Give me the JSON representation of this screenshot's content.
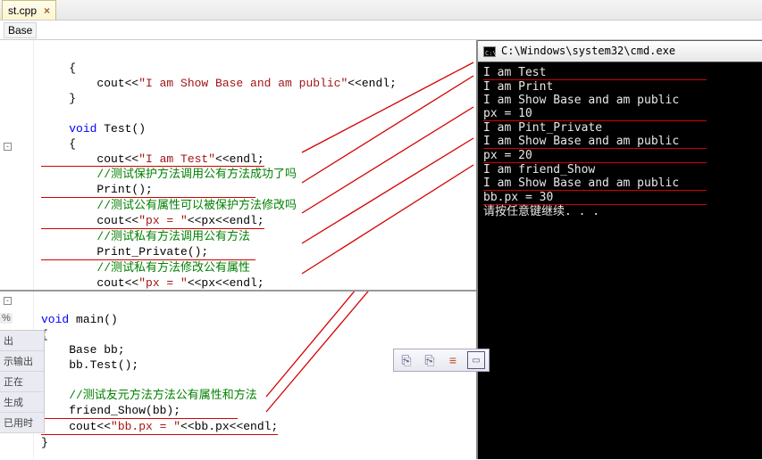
{
  "tab": {
    "name": "st.cpp",
    "close": "×"
  },
  "breadcrumb": {
    "item": "Base"
  },
  "code_top": {
    "l1": "    {",
    "l2a": "        cout<<",
    "l2b": "\"I am Show Base and am public\"",
    "l2c": "<<endl;",
    "l3": "    }",
    "l4": "",
    "l5a": "    ",
    "l5b": "void",
    "l5c": " Test()",
    "l6": "    {",
    "l7a": "        cout<<",
    "l7b": "\"I am Test\"",
    "l7c": "<<endl;",
    "l8": "        //测试保护方法调用公有方法成功了吗",
    "l9": "        Print();",
    "l10": "        //测试公有属性可以被保护方法修改吗",
    "l11a": "        cout<<",
    "l11b": "\"px = \"",
    "l11c": "<<px<<endl;",
    "l12": "        //测试私有方法调用公有方法",
    "l13": "        Print_Private();",
    "l14": "        //测试私有方法修改公有属性",
    "l15a": "        cout<<",
    "l15b": "\"px = \"",
    "l15c": "<<px<<endl;"
  },
  "code_bottom": {
    "l1a": "",
    "l1b": "void",
    "l1c": " main()",
    "l2": "{",
    "l3": "    Base bb;",
    "l4": "    bb.Test();",
    "l5": "",
    "l6": "    //测试友元方法方法公有属性和方法",
    "l7": "    friend_Show(bb);",
    "l8a": "    cout<<",
    "l8b": "\"bb.px = \"",
    "l8c": "<<bb.px<<endl;",
    "l9": "}"
  },
  "side": {
    "pct": "%",
    "s1": "出",
    "s2": "示输出",
    "s3": "  正在",
    "s4": "生成",
    "s5": "已用时"
  },
  "cmd": {
    "title": "C:\\Windows\\system32\\cmd.exe",
    "l1": "I am Test",
    "l2": "I am Print",
    "l3": "I am Show Base and am public",
    "l4": "px = 10",
    "l5": "I am Pint_Private",
    "l6": "I am Show Base and am public",
    "l7": "px = 20",
    "l8": "I am friend_Show",
    "l9": "I am Show Base and am public",
    "l10": "bb.px = 30",
    "l11": "请按任意键继续. . ."
  },
  "toolbar": {
    "b1": "⎘",
    "b2": "⎘",
    "b3": "≡",
    "b4": "▭"
  }
}
